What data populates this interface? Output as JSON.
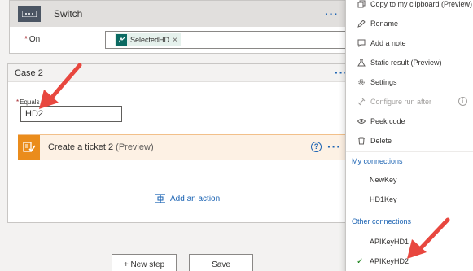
{
  "switch": {
    "title": "Switch",
    "more_label": "···",
    "on_label": "On",
    "required_mark": "*",
    "token_label": "SelectedHD",
    "token_remove": "×"
  },
  "case": {
    "title": "Case 2",
    "more_label": "···",
    "equals_label": "Equals",
    "required_mark": "*",
    "equals_value": "HD2",
    "action": {
      "title": "Create a ticket 2",
      "suffix": "(Preview)",
      "help": "?",
      "more_label": "···"
    },
    "add_action_label": "Add an action"
  },
  "buttons": {
    "new_step": "+ New step",
    "save": "Save"
  },
  "menu": {
    "items": [
      {
        "label": "Copy to my clipboard (Preview)",
        "icon": "copy-icon"
      },
      {
        "label": "Rename",
        "icon": "pencil-icon"
      },
      {
        "label": "Add a note",
        "icon": "note-icon"
      },
      {
        "label": "Static result (Preview)",
        "icon": "flask-icon"
      },
      {
        "label": "Settings",
        "icon": "gear-icon"
      },
      {
        "label": "Configure run after",
        "icon": "link-icon",
        "disabled": true
      },
      {
        "label": "Peek code",
        "icon": "eye-icon"
      },
      {
        "label": "Delete",
        "icon": "trash-icon"
      }
    ],
    "my_connections_header": "My connections",
    "my_connections": [
      "NewKey",
      "HD1Key"
    ],
    "other_connections_header": "Other connections",
    "other_connections": [
      "APIKeyHD1",
      "APIKeyHD2"
    ],
    "selected_connection": "APIKeyHD2"
  },
  "colors": {
    "accent": "#1b63b3",
    "annotation_arrow": "#e8473f",
    "action_orange": "#ea8c1c"
  }
}
